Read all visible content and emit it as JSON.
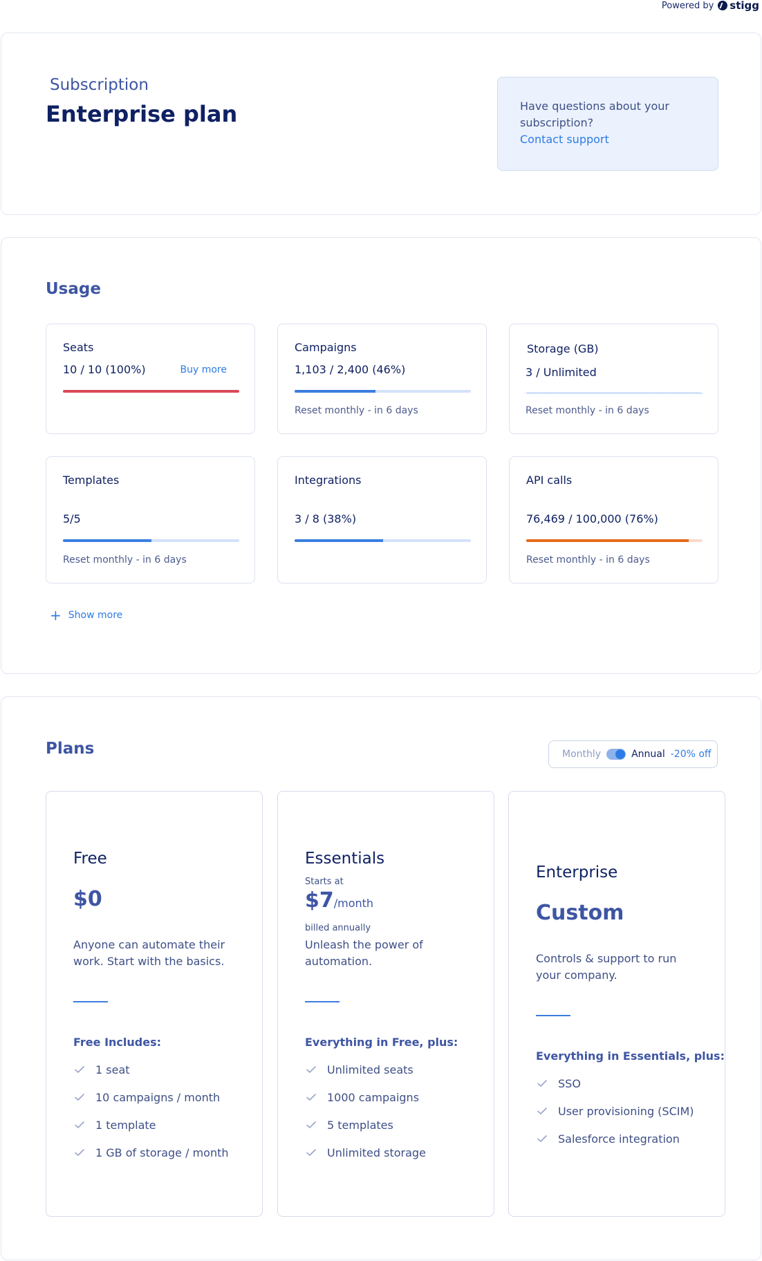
{
  "powered_by": {
    "label": "Powered by",
    "brand": "stigg"
  },
  "subscription": {
    "label": "Subscription",
    "plan_name": "Enterprise plan",
    "support_text": "Have questions about your subscription?",
    "support_link": "Contact support"
  },
  "usage": {
    "title": "Usage",
    "show_more": "Show more",
    "items": [
      {
        "name": "Seats",
        "value": "10 / 10 (100%)",
        "action": "Buy more",
        "progress": 1.0,
        "bar_color": "#d94a5a"
      },
      {
        "name": "Campaigns",
        "value": "1,103 / 2,400 (46%)",
        "progress": 0.46,
        "reset": "Reset monthly - in 6 days"
      },
      {
        "name": "Storage (GB)",
        "value": "3 / Unlimited",
        "progress": null,
        "reset": "Reset monthly - in 6 days"
      },
      {
        "name": "Templates",
        "value": "5/5",
        "progress": 0.5,
        "reset": "Reset monthly - in 6 days"
      },
      {
        "name": "Integrations",
        "value": "3 / 8 (38%)",
        "progress": 0.5
      },
      {
        "name": "API calls",
        "value": "76,469 / 100,000 (76%)",
        "progress": 0.92,
        "bar_color": "#e56a1b",
        "reset": "Reset monthly - in 6 days"
      }
    ]
  },
  "plans": {
    "title": "Plans",
    "toggle": {
      "monthly": "Monthly",
      "annual": "Annual",
      "discount": "-20% off"
    },
    "items": [
      {
        "name": "Free",
        "price": "$0",
        "description": "Anyone can automate their work. Start with the basics.",
        "includes_title": "Free Includes:",
        "features": [
          "1 seat",
          "10 campaigns / month",
          "1 template",
          "1 GB of storage / month"
        ]
      },
      {
        "name": "Essentials",
        "starts_at": "Starts at",
        "price": "$7",
        "price_unit": "/month",
        "billed": "billed annually",
        "description": "Unleash the power of automation.",
        "includes_title": "Everything in Free, plus:",
        "features": [
          "Unlimited seats",
          "1000 campaigns",
          "5 templates",
          "Unlimited storage"
        ]
      },
      {
        "name": "Enterprise",
        "price": "Custom",
        "description": "Controls & support to run your company.",
        "includes_title": "Everything in Essentials, plus:",
        "features": [
          "SSO",
          "User provisioning (SCIM)",
          "Salesforce integration"
        ]
      }
    ]
  }
}
